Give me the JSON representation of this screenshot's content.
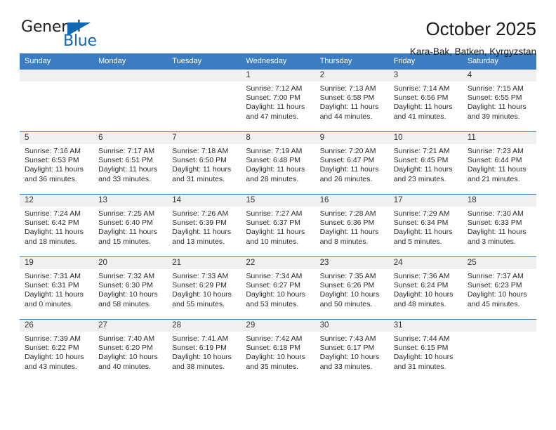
{
  "logo": {
    "word_top": "General",
    "word_bottom": "Blue",
    "triangle_color": "#1068b3"
  },
  "header": {
    "title": "October 2025",
    "subtitle": "Kara-Bak, Batken, Kyrgyzstan"
  },
  "colors": {
    "header_blue": "#3b7dc0",
    "daynum_band": "#f0f0f0",
    "logo_blue": "#1068b3"
  },
  "calendar": {
    "weekday_headers": [
      "Sunday",
      "Monday",
      "Tuesday",
      "Wednesday",
      "Thursday",
      "Friday",
      "Saturday"
    ],
    "labels": {
      "sunrise": "Sunrise:",
      "sunset": "Sunset:",
      "daylight": "Daylight:"
    },
    "weeks": [
      [
        {
          "day": "",
          "sunrise": "",
          "sunset": "",
          "daylight_line1": "",
          "daylight_line2": ""
        },
        {
          "day": "",
          "sunrise": "",
          "sunset": "",
          "daylight_line1": "",
          "daylight_line2": ""
        },
        {
          "day": "",
          "sunrise": "",
          "sunset": "",
          "daylight_line1": "",
          "daylight_line2": ""
        },
        {
          "day": "1",
          "sunrise": "Sunrise: 7:12 AM",
          "sunset": "Sunset: 7:00 PM",
          "daylight_line1": "Daylight: 11 hours",
          "daylight_line2": "and 47 minutes."
        },
        {
          "day": "2",
          "sunrise": "Sunrise: 7:13 AM",
          "sunset": "Sunset: 6:58 PM",
          "daylight_line1": "Daylight: 11 hours",
          "daylight_line2": "and 44 minutes."
        },
        {
          "day": "3",
          "sunrise": "Sunrise: 7:14 AM",
          "sunset": "Sunset: 6:56 PM",
          "daylight_line1": "Daylight: 11 hours",
          "daylight_line2": "and 41 minutes."
        },
        {
          "day": "4",
          "sunrise": "Sunrise: 7:15 AM",
          "sunset": "Sunset: 6:55 PM",
          "daylight_line1": "Daylight: 11 hours",
          "daylight_line2": "and 39 minutes."
        }
      ],
      [
        {
          "day": "5",
          "sunrise": "Sunrise: 7:16 AM",
          "sunset": "Sunset: 6:53 PM",
          "daylight_line1": "Daylight: 11 hours",
          "daylight_line2": "and 36 minutes."
        },
        {
          "day": "6",
          "sunrise": "Sunrise: 7:17 AM",
          "sunset": "Sunset: 6:51 PM",
          "daylight_line1": "Daylight: 11 hours",
          "daylight_line2": "and 33 minutes."
        },
        {
          "day": "7",
          "sunrise": "Sunrise: 7:18 AM",
          "sunset": "Sunset: 6:50 PM",
          "daylight_line1": "Daylight: 11 hours",
          "daylight_line2": "and 31 minutes."
        },
        {
          "day": "8",
          "sunrise": "Sunrise: 7:19 AM",
          "sunset": "Sunset: 6:48 PM",
          "daylight_line1": "Daylight: 11 hours",
          "daylight_line2": "and 28 minutes."
        },
        {
          "day": "9",
          "sunrise": "Sunrise: 7:20 AM",
          "sunset": "Sunset: 6:47 PM",
          "daylight_line1": "Daylight: 11 hours",
          "daylight_line2": "and 26 minutes."
        },
        {
          "day": "10",
          "sunrise": "Sunrise: 7:21 AM",
          "sunset": "Sunset: 6:45 PM",
          "daylight_line1": "Daylight: 11 hours",
          "daylight_line2": "and 23 minutes."
        },
        {
          "day": "11",
          "sunrise": "Sunrise: 7:23 AM",
          "sunset": "Sunset: 6:44 PM",
          "daylight_line1": "Daylight: 11 hours",
          "daylight_line2": "and 21 minutes."
        }
      ],
      [
        {
          "day": "12",
          "sunrise": "Sunrise: 7:24 AM",
          "sunset": "Sunset: 6:42 PM",
          "daylight_line1": "Daylight: 11 hours",
          "daylight_line2": "and 18 minutes."
        },
        {
          "day": "13",
          "sunrise": "Sunrise: 7:25 AM",
          "sunset": "Sunset: 6:40 PM",
          "daylight_line1": "Daylight: 11 hours",
          "daylight_line2": "and 15 minutes."
        },
        {
          "day": "14",
          "sunrise": "Sunrise: 7:26 AM",
          "sunset": "Sunset: 6:39 PM",
          "daylight_line1": "Daylight: 11 hours",
          "daylight_line2": "and 13 minutes."
        },
        {
          "day": "15",
          "sunrise": "Sunrise: 7:27 AM",
          "sunset": "Sunset: 6:37 PM",
          "daylight_line1": "Daylight: 11 hours",
          "daylight_line2": "and 10 minutes."
        },
        {
          "day": "16",
          "sunrise": "Sunrise: 7:28 AM",
          "sunset": "Sunset: 6:36 PM",
          "daylight_line1": "Daylight: 11 hours",
          "daylight_line2": "and 8 minutes."
        },
        {
          "day": "17",
          "sunrise": "Sunrise: 7:29 AM",
          "sunset": "Sunset: 6:34 PM",
          "daylight_line1": "Daylight: 11 hours",
          "daylight_line2": "and 5 minutes."
        },
        {
          "day": "18",
          "sunrise": "Sunrise: 7:30 AM",
          "sunset": "Sunset: 6:33 PM",
          "daylight_line1": "Daylight: 11 hours",
          "daylight_line2": "and 3 minutes."
        }
      ],
      [
        {
          "day": "19",
          "sunrise": "Sunrise: 7:31 AM",
          "sunset": "Sunset: 6:31 PM",
          "daylight_line1": "Daylight: 11 hours",
          "daylight_line2": "and 0 minutes."
        },
        {
          "day": "20",
          "sunrise": "Sunrise: 7:32 AM",
          "sunset": "Sunset: 6:30 PM",
          "daylight_line1": "Daylight: 10 hours",
          "daylight_line2": "and 58 minutes."
        },
        {
          "day": "21",
          "sunrise": "Sunrise: 7:33 AM",
          "sunset": "Sunset: 6:29 PM",
          "daylight_line1": "Daylight: 10 hours",
          "daylight_line2": "and 55 minutes."
        },
        {
          "day": "22",
          "sunrise": "Sunrise: 7:34 AM",
          "sunset": "Sunset: 6:27 PM",
          "daylight_line1": "Daylight: 10 hours",
          "daylight_line2": "and 53 minutes."
        },
        {
          "day": "23",
          "sunrise": "Sunrise: 7:35 AM",
          "sunset": "Sunset: 6:26 PM",
          "daylight_line1": "Daylight: 10 hours",
          "daylight_line2": "and 50 minutes."
        },
        {
          "day": "24",
          "sunrise": "Sunrise: 7:36 AM",
          "sunset": "Sunset: 6:24 PM",
          "daylight_line1": "Daylight: 10 hours",
          "daylight_line2": "and 48 minutes."
        },
        {
          "day": "25",
          "sunrise": "Sunrise: 7:37 AM",
          "sunset": "Sunset: 6:23 PM",
          "daylight_line1": "Daylight: 10 hours",
          "daylight_line2": "and 45 minutes."
        }
      ],
      [
        {
          "day": "26",
          "sunrise": "Sunrise: 7:39 AM",
          "sunset": "Sunset: 6:22 PM",
          "daylight_line1": "Daylight: 10 hours",
          "daylight_line2": "and 43 minutes."
        },
        {
          "day": "27",
          "sunrise": "Sunrise: 7:40 AM",
          "sunset": "Sunset: 6:20 PM",
          "daylight_line1": "Daylight: 10 hours",
          "daylight_line2": "and 40 minutes."
        },
        {
          "day": "28",
          "sunrise": "Sunrise: 7:41 AM",
          "sunset": "Sunset: 6:19 PM",
          "daylight_line1": "Daylight: 10 hours",
          "daylight_line2": "and 38 minutes."
        },
        {
          "day": "29",
          "sunrise": "Sunrise: 7:42 AM",
          "sunset": "Sunset: 6:18 PM",
          "daylight_line1": "Daylight: 10 hours",
          "daylight_line2": "and 35 minutes."
        },
        {
          "day": "30",
          "sunrise": "Sunrise: 7:43 AM",
          "sunset": "Sunset: 6:17 PM",
          "daylight_line1": "Daylight: 10 hours",
          "daylight_line2": "and 33 minutes."
        },
        {
          "day": "31",
          "sunrise": "Sunrise: 7:44 AM",
          "sunset": "Sunset: 6:15 PM",
          "daylight_line1": "Daylight: 10 hours",
          "daylight_line2": "and 31 minutes."
        },
        {
          "day": "",
          "sunrise": "",
          "sunset": "",
          "daylight_line1": "",
          "daylight_line2": ""
        }
      ]
    ]
  }
}
